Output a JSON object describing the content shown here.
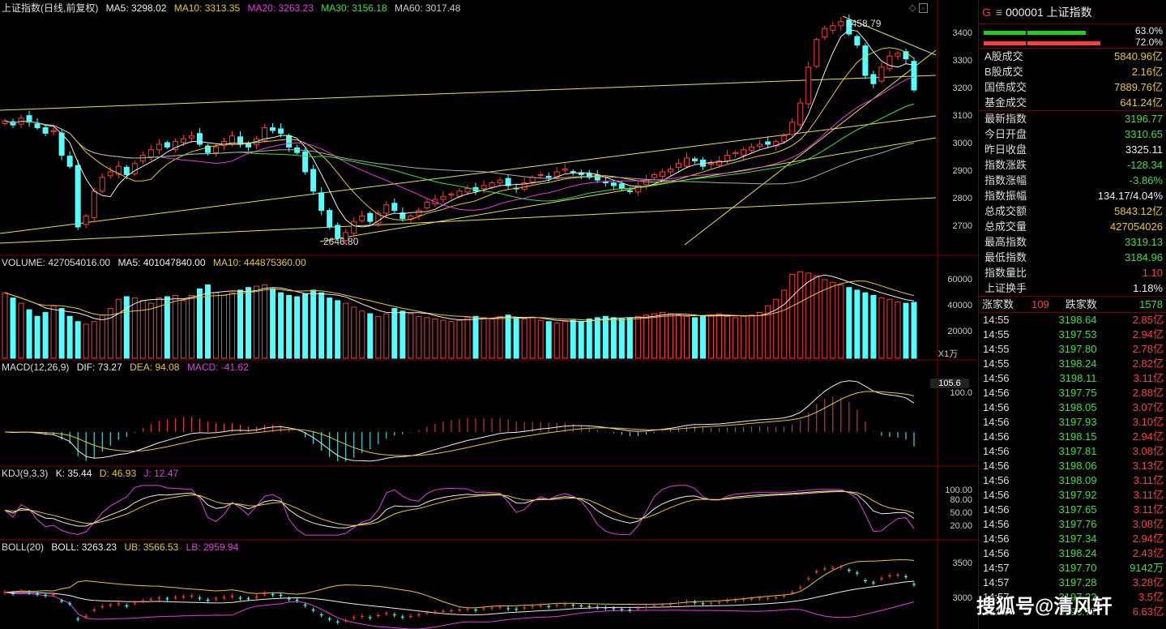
{
  "panels": {
    "main": {
      "title": "上证指数(日线,前复权)",
      "ma5": "MA5: 3298.02",
      "ma10": "MA10: 3313.35",
      "ma20": "MA20: 3263.23",
      "ma30": "MA30: 3156.18",
      "ma60": "MA60: 3017.48",
      "y_labels": [
        "3400",
        "3300",
        "3200",
        "3100",
        "3000",
        "2900",
        "2800",
        "2700"
      ],
      "high_label": "3458.79",
      "low_label": "2646.80"
    },
    "volume": {
      "title": "VOLUME: 427054016.00",
      "ma5": "MA5: 401047840.00",
      "ma10": "MA10: 444875360.00",
      "y_labels": [
        "60000",
        "40000",
        "20000"
      ],
      "unit": "X1万"
    },
    "macd": {
      "title": "MACD(12,26,9)",
      "dif": "DIF: 73.27",
      "dea": "DEA: 94.08",
      "macd": "MACD: -41.62",
      "y_labels": [
        "105.6",
        "100.0"
      ]
    },
    "kdj": {
      "title": "KDJ(9,3,3)",
      "k": "K: 35.44",
      "d": "D: 46.93",
      "j": "J: 12.47",
      "y_labels": [
        "100.00",
        "80.00",
        "50.00",
        "20.00"
      ]
    },
    "boll": {
      "title": "BOLL(20)",
      "boll": "BOLL: 3263.23",
      "ub": "UB: 3566.53",
      "lb": "LB: 2959.94",
      "y_labels": [
        "3500",
        "3000"
      ]
    }
  },
  "chart_data": {
    "type": "candlestick",
    "closes": [
      3085,
      3070,
      3095,
      3080,
      3060,
      3040,
      3050,
      2960,
      2920,
      2700,
      2740,
      2830,
      2880,
      2900,
      2920,
      2890,
      2930,
      2960,
      2980,
      3000,
      2990,
      3010,
      3020,
      3030,
      3000,
      2970,
      2990,
      3010,
      3030,
      3000,
      2990,
      3020,
      3060,
      3050,
      3040,
      2990,
      2970,
      2900,
      2830,
      2760,
      2700,
      2660,
      2680,
      2720,
      2740,
      2720,
      2750,
      2780,
      2760,
      2730,
      2740,
      2760,
      2790,
      2800,
      2810,
      2820,
      2830,
      2840,
      2830,
      2850,
      2860,
      2870,
      2850,
      2840,
      2860,
      2880,
      2890,
      2880,
      2900,
      2910,
      2900,
      2890,
      2880,
      2870,
      2860,
      2850,
      2840,
      2830,
      2850,
      2870,
      2890,
      2900,
      2910,
      2930,
      2950,
      2940,
      2920,
      2930,
      2940,
      2960,
      2970,
      2980,
      2990,
      3000,
      3000,
      3010,
      3030,
      3080,
      3150,
      3280,
      3380,
      3420,
      3430,
      3445,
      3400,
      3360,
      3250,
      3220,
      3280,
      3320,
      3330,
      3310,
      3197
    ],
    "volume_yi": [
      5000,
      4600,
      4200,
      3700,
      3200,
      3500,
      4000,
      3800,
      3200,
      2800,
      2600,
      2800,
      3300,
      3800,
      4500,
      4700,
      4600,
      4400,
      4200,
      4600,
      4700,
      4800,
      4400,
      4800,
      5300,
      5600,
      5000,
      4800,
      5000,
      5200,
      5400,
      5500,
      5600,
      5300,
      5000,
      4800,
      4700,
      4900,
      5200,
      5000,
      4600,
      4400,
      4200,
      3900,
      3600,
      3400,
      3200,
      3400,
      3800,
      3600,
      3400,
      3200,
      3100,
      3000,
      2900,
      2800,
      2900,
      3100,
      3200,
      3100,
      3000,
      3200,
      3300,
      3100,
      3000,
      3100,
      2900,
      2800,
      2700,
      2800,
      2900,
      2800,
      3000,
      3100,
      3200,
      3100,
      3000,
      3100,
      3200,
      3300,
      3400,
      3500,
      3400,
      3300,
      3200,
      3100,
      3200,
      3300,
      3400,
      3200,
      3100,
      3200,
      3300,
      3500,
      4000,
      4500,
      5200,
      6400,
      6600,
      6500,
      6300,
      6000,
      5800,
      5600,
      5400,
      5200,
      5000,
      4800,
      4600,
      4500,
      4300,
      4200,
      4270
    ],
    "macd": {
      "dif": 73.27,
      "dea": 94.08,
      "hist": -41.62
    },
    "kdj": {
      "k": 35.44,
      "d": 46.93,
      "j": 12.47
    },
    "boll": {
      "mid": 3263.23,
      "ub": 3566.53,
      "lb": 2959.94
    }
  },
  "right_panel": {
    "code_prefix": "G",
    "menu_icon": "≡",
    "title": "000001 上证指数",
    "bar_pct_up": "63.0%",
    "bar_pct_down": "72.0%",
    "section1": [
      {
        "k": "A股成交",
        "v": "5840.96亿",
        "c": "yellow"
      },
      {
        "k": "B股成交",
        "v": "2.16亿",
        "c": "yellow"
      },
      {
        "k": "国债成交",
        "v": "7889.76亿",
        "c": "yellow"
      },
      {
        "k": "基金成交",
        "v": "641.24亿",
        "c": "yellow"
      }
    ],
    "section2": [
      {
        "k": "最新指数",
        "v": "3196.77",
        "c": "green"
      },
      {
        "k": "今日开盘",
        "v": "3310.65",
        "c": "green"
      },
      {
        "k": "昨日收盘",
        "v": "3325.11",
        "c": "white"
      },
      {
        "k": "指数涨跌",
        "v": "-128.34",
        "c": "green"
      },
      {
        "k": "指数涨幅",
        "v": "-3.86%",
        "c": "green"
      },
      {
        "k": "指数振幅",
        "v": "134.17/4.04%",
        "c": "white"
      },
      {
        "k": "总成交额",
        "v": "5843.12亿",
        "c": "yellow"
      },
      {
        "k": "总成交量",
        "v": "427054026",
        "c": "yellow"
      },
      {
        "k": "最高指数",
        "v": "3319.13",
        "c": "green"
      },
      {
        "k": "最低指数",
        "v": "3184.96",
        "c": "green"
      },
      {
        "k": "指数量比",
        "v": "1.10",
        "c": "red"
      },
      {
        "k": "上证换手",
        "v": "1.18%",
        "c": "white"
      }
    ],
    "up_label": "涨家数",
    "up_count": "109",
    "down_label": "跌家数",
    "down_count": "1578",
    "ticks": [
      {
        "t": "14:55",
        "p": "3198.64",
        "v": "2.85亿"
      },
      {
        "t": "14:55",
        "p": "3197.53",
        "v": "2.94亿"
      },
      {
        "t": "14:55",
        "p": "3197.80",
        "v": "2.78亿"
      },
      {
        "t": "14:55",
        "p": "3198.24",
        "v": "2.82亿"
      },
      {
        "t": "14:56",
        "p": "3198.11",
        "v": "3.11亿"
      },
      {
        "t": "14:56",
        "p": "3197.75",
        "v": "2.88亿"
      },
      {
        "t": "14:56",
        "p": "3198.05",
        "v": "3.07亿"
      },
      {
        "t": "14:56",
        "p": "3197.93",
        "v": "3.10亿"
      },
      {
        "t": "14:56",
        "p": "3198.15",
        "v": "2.94亿"
      },
      {
        "t": "14:56",
        "p": "3197.81",
        "v": "3.08亿"
      },
      {
        "t": "14:56",
        "p": "3198.06",
        "v": "3.13亿"
      },
      {
        "t": "14:56",
        "p": "3198.09",
        "v": "3.11亿"
      },
      {
        "t": "14:56",
        "p": "3197.92",
        "v": "3.11亿"
      },
      {
        "t": "14:56",
        "p": "3197.65",
        "v": "3.11亿"
      },
      {
        "t": "14:56",
        "p": "3197.76",
        "v": "3.08亿"
      },
      {
        "t": "14:56",
        "p": "3197.34",
        "v": "2.94亿"
      },
      {
        "t": "14:56",
        "p": "3198.24",
        "v": "2.43亿"
      },
      {
        "t": "14:57",
        "p": "3197.70",
        "v": "9142万"
      },
      {
        "t": "14:57",
        "p": "3197.28",
        "v": "3.28亿"
      },
      {
        "t": "14:57",
        "p": "3197.22",
        "v": "3.5亿"
      },
      {
        "t": "15:00",
        "p": "3196.77",
        "v": "6.63亿"
      }
    ]
  },
  "watermark": "搜狐号@清风轩"
}
